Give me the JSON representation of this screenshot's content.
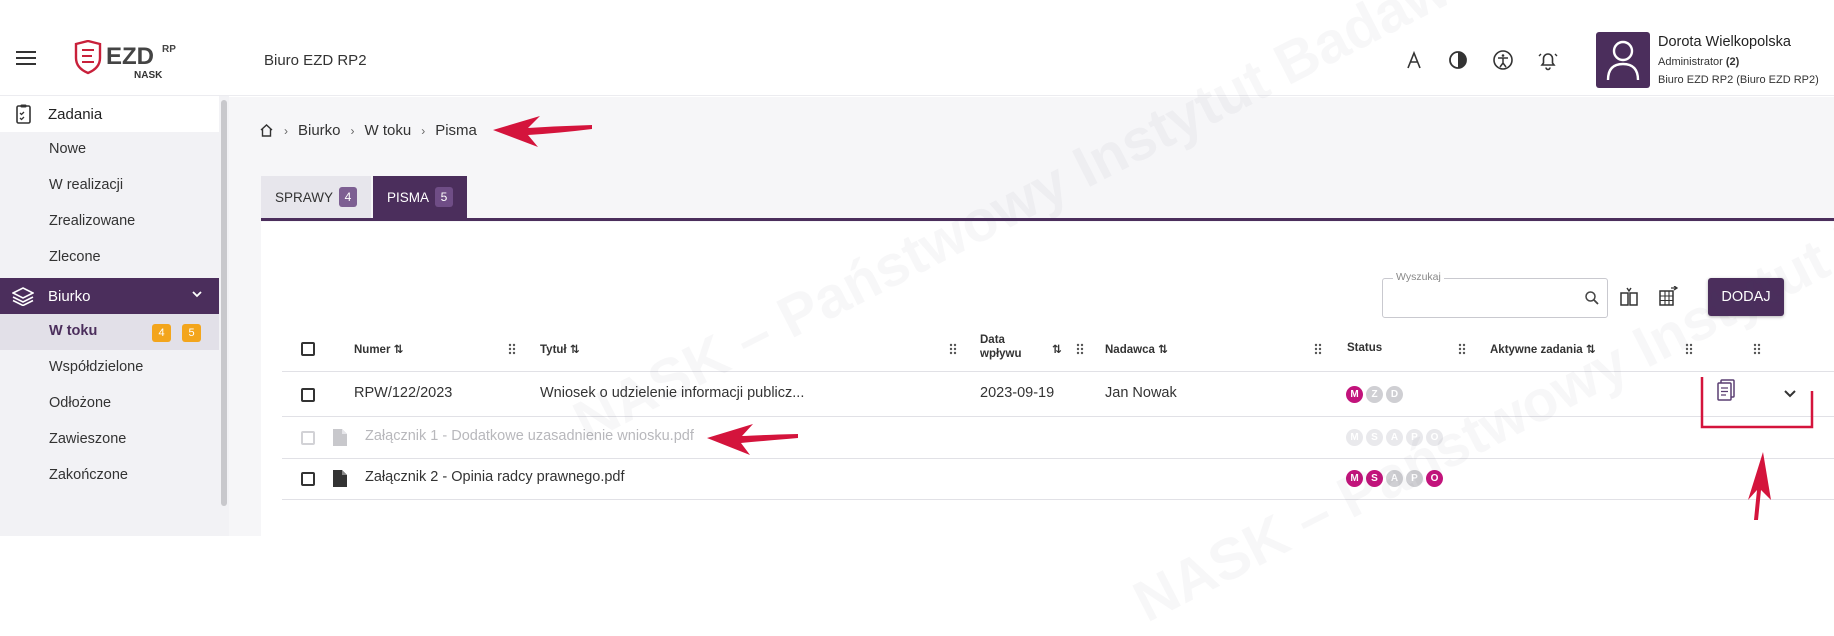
{
  "header": {
    "brand": "Biuro EZD RP2",
    "logo_text": "EZD RP NASK",
    "icons": [
      "font-size-icon",
      "contrast-icon",
      "accessibility-icon",
      "bell-icon"
    ]
  },
  "user": {
    "name": "Dorota Wielkopolska",
    "role": "Administrator",
    "role_count": "(2)",
    "org": "Biuro EZD RP2 (Biuro EZD RP2)"
  },
  "sidebar": {
    "section1": "Zadania",
    "items1": [
      "Nowe",
      "W realizacji",
      "Zrealizowane",
      "Zlecone"
    ],
    "section2": "Biurko",
    "active": "W toku",
    "active_badges": [
      "4",
      "5"
    ],
    "items2": [
      "Współdzielone",
      "Odłożone",
      "Zawieszone",
      "Zakończone"
    ]
  },
  "breadcrumb": [
    "Biurko",
    "W toku",
    "Pisma"
  ],
  "tabs": [
    {
      "label": "SPRAWY",
      "count": "4"
    },
    {
      "label": "PISMA",
      "count": "5"
    }
  ],
  "search": {
    "placeholder": "Wyszukaj"
  },
  "add_button": "DODAJ",
  "table": {
    "headers": {
      "numer": "Numer",
      "tytul": "Tytuł",
      "data1": "Data",
      "data2": "wpływu",
      "nadawca": "Nadawca",
      "status": "Status",
      "aktywne": "Aktywne zadania"
    },
    "row1": {
      "numer": "RPW/122/2023",
      "tytul": "Wniosek o udzielenie informacji publicz...",
      "data": "2023-09-19",
      "nadawca": "Jan Nowak",
      "status": [
        "M",
        "Z",
        "D"
      ]
    },
    "att1": {
      "name": "Załącznik 1 - Dodatkowe uzasadnienie wniosku.pdf",
      "status": [
        "M",
        "S",
        "A",
        "P",
        "O"
      ]
    },
    "att2": {
      "name": "Załącznik 2 - Opinia radcy prawnego.pdf",
      "status": [
        "M",
        "S",
        "A",
        "P",
        "O"
      ]
    }
  },
  "watermark": "NASK – Państwowy Instytut Badawczy",
  "colors": {
    "primary": "#4b2e5c",
    "badge": "#f3a51c",
    "status_active": "#c2137b",
    "annotation": "#d4143c"
  }
}
